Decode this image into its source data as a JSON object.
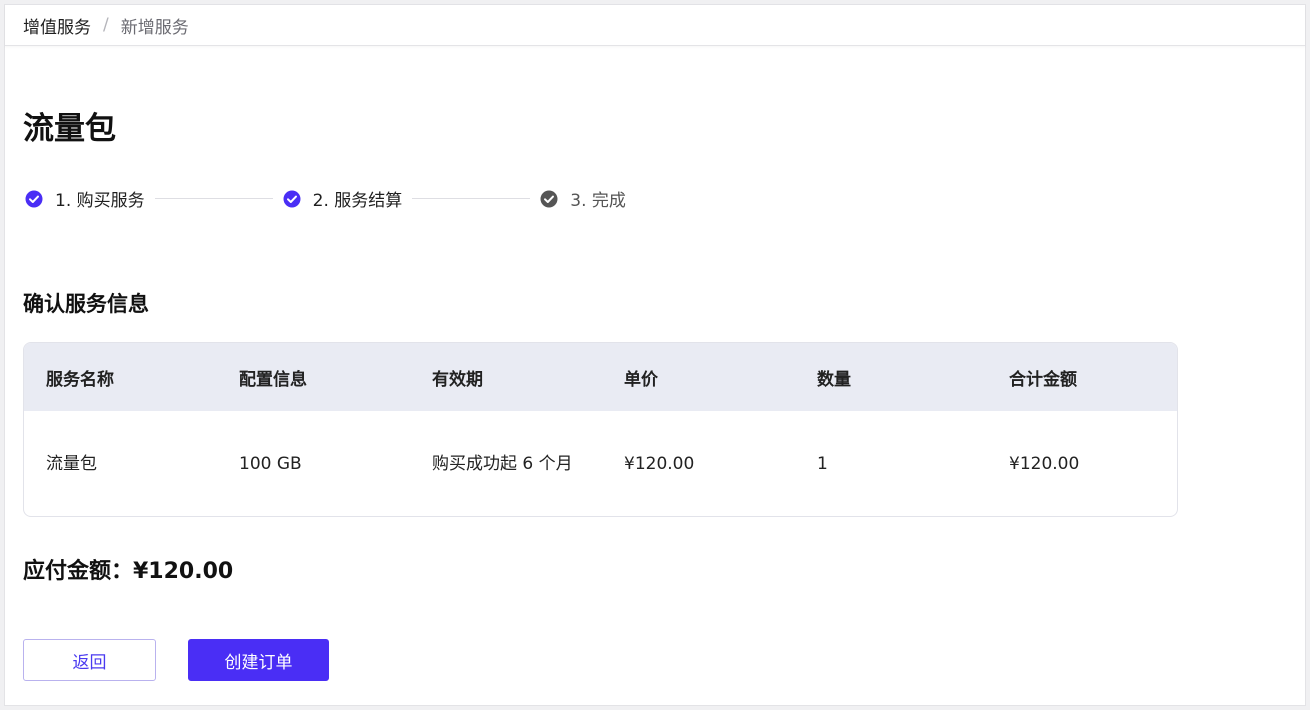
{
  "breadcrumb": {
    "root": "增值服务",
    "separator": "/",
    "current": "新增服务"
  },
  "page": {
    "title": "流量包"
  },
  "steps": [
    {
      "label": "1. 购买服务",
      "status": "done"
    },
    {
      "label": "2. 服务结算",
      "status": "done"
    },
    {
      "label": "3. 完成",
      "status": "pending"
    }
  ],
  "section": {
    "title": "确认服务信息"
  },
  "table": {
    "headers": [
      "服务名称",
      "配置信息",
      "有效期",
      "单价",
      "数量",
      "合计金额"
    ],
    "rows": [
      [
        "流量包",
        "100 GB",
        "购买成功起 6 个月",
        "¥120.00",
        "1",
        "¥120.00"
      ]
    ]
  },
  "summary": {
    "payable_text": "应付金额：¥120.00"
  },
  "actions": {
    "back_label": "返回",
    "create_label": "创建订单"
  },
  "colors": {
    "accent": "#4a2ef5",
    "step_done": "#4a2ef5",
    "step_pending": "#555555",
    "table_header_bg": "#e9ebf3"
  },
  "icons": {
    "step_done": "check-circle-icon",
    "step_pending": "check-circle-icon"
  }
}
